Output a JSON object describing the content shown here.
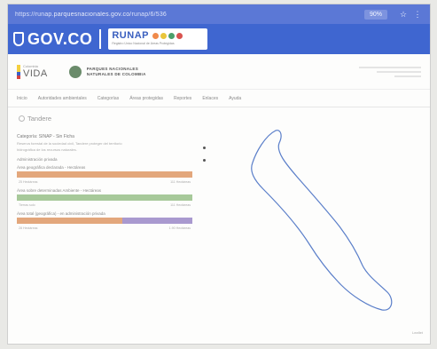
{
  "browser": {
    "url_prefix": "https://runap.",
    "url_highlight": "parquesnacionales.gov.co",
    "url_suffix": "/runap/6/536",
    "zoom": "90%",
    "star_icon": "star-icon",
    "menu_icon": "menu-icon"
  },
  "gov": {
    "logo_text": "GOV.CO",
    "runap_title": "RUNAP",
    "runap_subtitle": "Registro Único Nacional de Áreas Protegidas",
    "runap_dot_colors": [
      "#f08a4b",
      "#e9c53b",
      "#4c9f6a",
      "#d9534f"
    ]
  },
  "institution": {
    "vida_small": "Colombia",
    "vida_big": "VIDA",
    "pnn_line1": "PARQUES NACIONALES",
    "pnn_line2": "NATURALES DE COLOMBIA"
  },
  "nav": {
    "items": [
      "Inicio",
      "Autoridades ambientales",
      "Categorías",
      "Áreas protegidas",
      "Reportes",
      "Enlaces",
      "Ayuda"
    ]
  },
  "page": {
    "title": "Tandere"
  },
  "details": {
    "category": "Categoría: SINAP - Sin Ficha",
    "line1": "Reserva forestal de la sociedad civil, Tandere proteger del territorio",
    "line2": "hidrográfica de los recursos naturales.",
    "section": "Administración privada"
  },
  "bars": [
    {
      "label": "Área geográfica declarada - Hectáreas",
      "left_meta": "25 Hectáreas",
      "right_meta": "111 Hectáreas",
      "segments": [
        {
          "color": "#e3a77c",
          "fraction": 1.0
        }
      ]
    },
    {
      "label": "Área sobre determinadas Ambiente - Hectáreas",
      "left_meta": "Tierras solo",
      "right_meta": "111 Hectáreas",
      "segments": [
        {
          "color": "#a7c99a",
          "fraction": 1.0
        }
      ]
    },
    {
      "label": "Área total (geográfica) - en administración privada",
      "left_meta": "28 Hectáreas",
      "right_meta": "1.90 Hectáreas",
      "segments": [
        {
          "color": "#e3a77c",
          "fraction": 0.6
        },
        {
          "color": "#a999cf",
          "fraction": 0.4
        }
      ]
    }
  ],
  "map": {
    "outline_color": "#5a7ec9",
    "zoom_label": "Leaflet"
  }
}
